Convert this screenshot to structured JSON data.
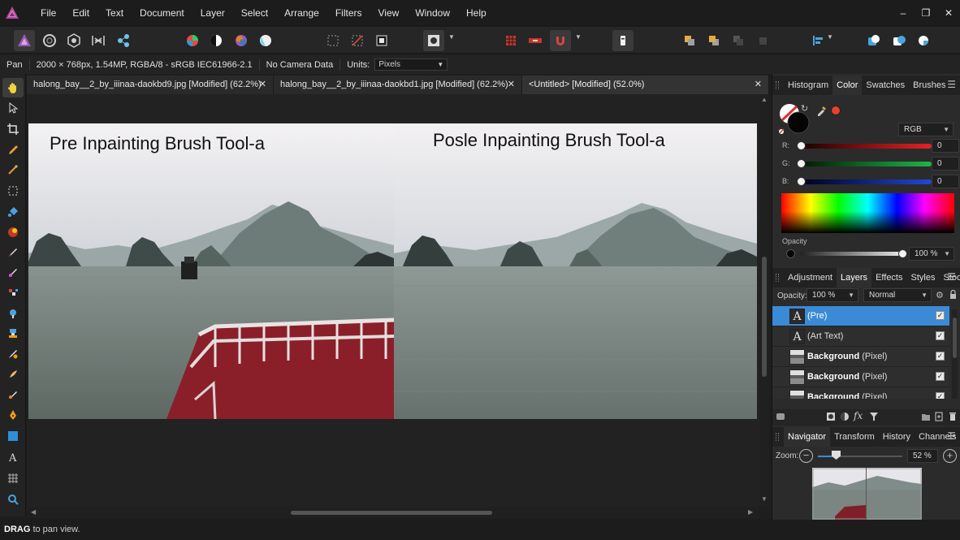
{
  "menu": [
    "File",
    "Edit",
    "Text",
    "Document",
    "Layer",
    "Select",
    "Arrange",
    "Filters",
    "View",
    "Window",
    "Help"
  ],
  "window_controls": {
    "minimize": "–",
    "restore": "❐",
    "close": "✕"
  },
  "context": {
    "tool": "Pan",
    "doc_info": "2000 × 768px, 1.54MP, RGBA/8 - sRGB IEC61966-2.1",
    "camera": "No Camera Data",
    "units_label": "Units:",
    "units_value": "Pixels"
  },
  "tabs": [
    {
      "title": "halong_bay__2_by_iiinaa-daokbd9.jpg [Modified] (62.2%)",
      "close": "✕"
    },
    {
      "title": "halong_bay__2_by_iiinaa-daokbd1.jpg [Modified] (62.2%)",
      "close": "✕"
    },
    {
      "title": "<Untitled> [Modified] (52.0%)",
      "close": "✕"
    }
  ],
  "canvas": {
    "left_caption": "Pre Inpainting Brush Tool-a",
    "right_caption": "Posle Inpainting Brush Tool-a"
  },
  "status": {
    "key": "DRAG",
    "text": " to pan view."
  },
  "color_panel": {
    "tabs": [
      "Histogram",
      "Color",
      "Swatches",
      "Brushes"
    ],
    "active_tab": "Color",
    "mode": "RGB",
    "r_label": "R:",
    "r_value": "0",
    "g_label": "G:",
    "g_value": "0",
    "b_label": "B:",
    "b_value": "0",
    "opacity_label": "Opacity",
    "opacity_value": "100 %",
    "accent_red": "#e8412c"
  },
  "layers_panel": {
    "tabs": [
      "Adjustment",
      "Layers",
      "Effects",
      "Styles",
      "Stock"
    ],
    "active_tab": "Layers",
    "opacity_label": "Opacity:",
    "opacity_value": "100 %",
    "blend_mode": "Normal",
    "layers": [
      {
        "name": "(Pre)",
        "bold": "",
        "kind": "text",
        "selected": true,
        "thumb": "A"
      },
      {
        "name": "(Art Text)",
        "bold": "",
        "kind": "text",
        "selected": false,
        "thumb": "A"
      },
      {
        "name": " (Pixel)",
        "bold": "Background",
        "kind": "pixel",
        "selected": false,
        "thumb": ""
      },
      {
        "name": " (Pixel)",
        "bold": "Background",
        "kind": "pixel",
        "selected": false,
        "thumb": ""
      },
      {
        "name": " (Pixel)",
        "bold": "Background",
        "kind": "pixel",
        "selected": false,
        "thumb": ""
      }
    ],
    "checkmark": "✓"
  },
  "navigator_panel": {
    "tabs": [
      "Navigator",
      "Transform",
      "History",
      "Channels"
    ],
    "active_tab": "Navigator",
    "zoom_label": "Zoom:",
    "zoom_value": "52 %",
    "zoom_level": 0.52
  },
  "colors": {
    "selection_blue": "#3b8ad6",
    "panel_bg": "#2b2b2b",
    "canvas_bg": "#222222"
  }
}
